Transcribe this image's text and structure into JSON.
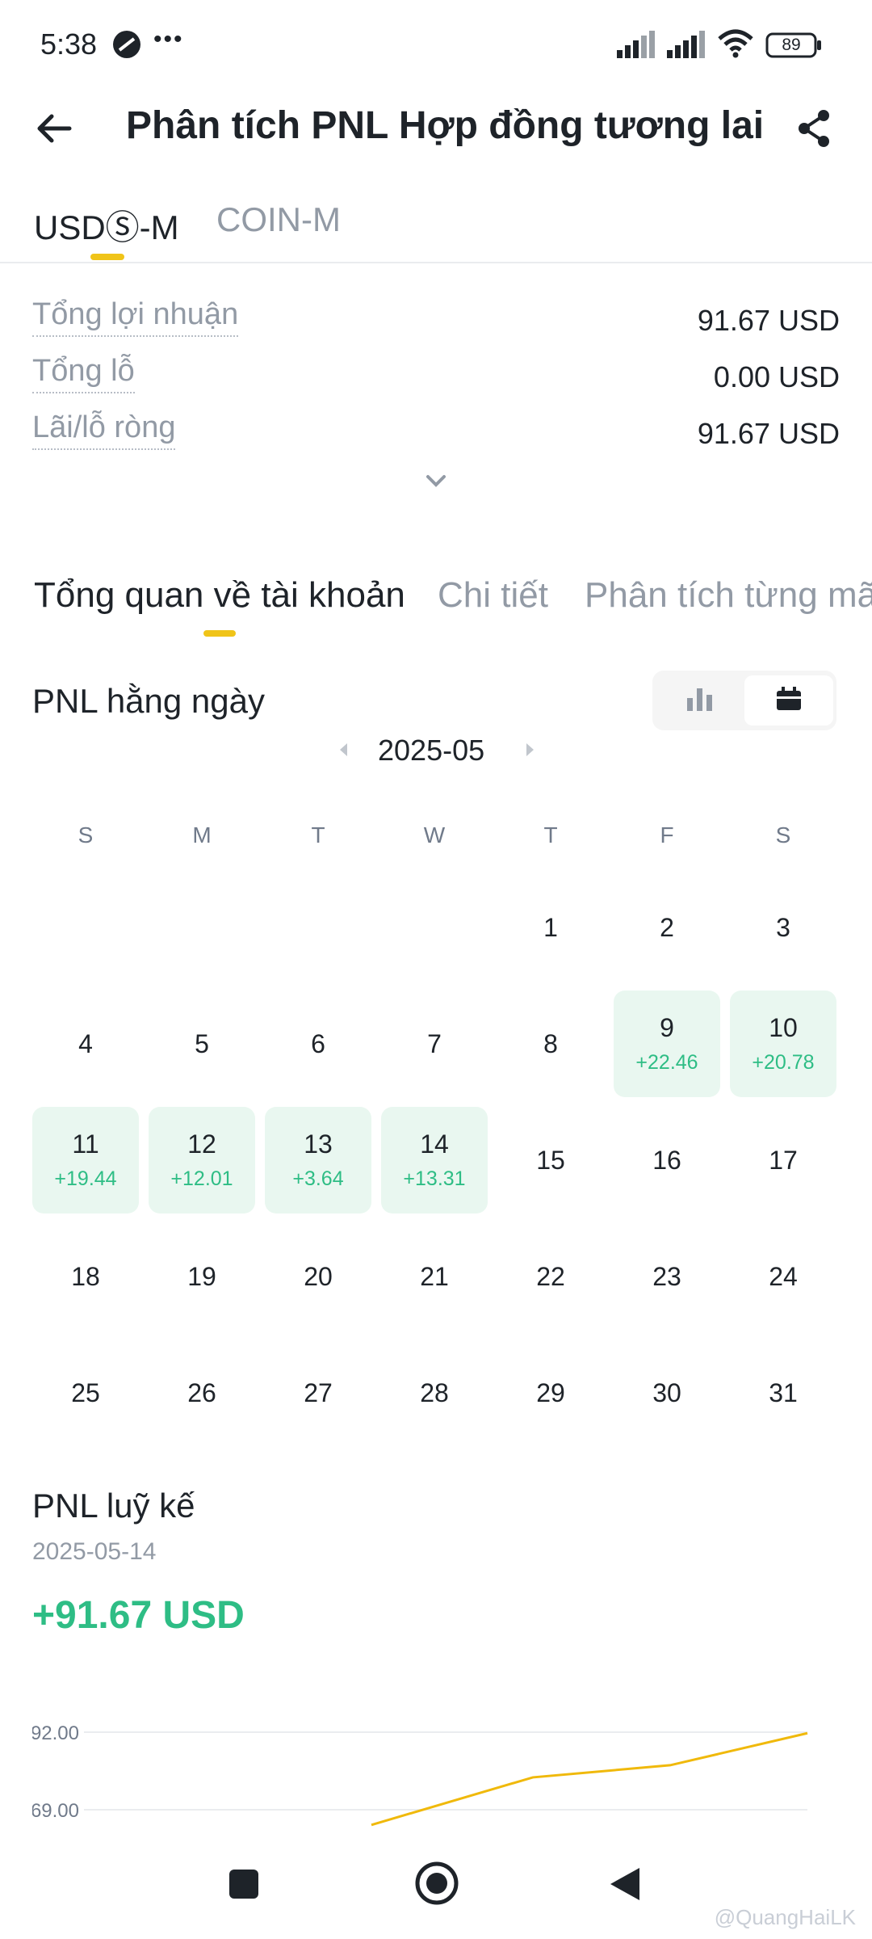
{
  "status_bar": {
    "time": "5:38",
    "dots": "•••",
    "battery": "89"
  },
  "header": {
    "title": "Phân tích PNL Hợp đồng tương lai"
  },
  "contract_tabs": [
    {
      "label": "USDⓈ-M",
      "active": true
    },
    {
      "label": "COIN-M",
      "active": false
    }
  ],
  "summary": [
    {
      "label": "Tổng lợi nhuận",
      "value": "91.67 USD"
    },
    {
      "label": "Tổng lỗ",
      "value": "0.00 USD"
    },
    {
      "label": "Lãi/lỗ ròng",
      "value": "91.67 USD"
    }
  ],
  "section_tabs": [
    {
      "label": "Tổng quan về tài khoản",
      "active": true
    },
    {
      "label": "Chi tiết",
      "active": false
    },
    {
      "label": "Phân tích từng mã",
      "active": false
    }
  ],
  "daily_pnl": {
    "title": "PNL hằng ngày",
    "month": "2025-05",
    "view_icons": [
      "bar-chart-icon",
      "calendar-icon"
    ],
    "active_view": "calendar",
    "weekdays": [
      "S",
      "M",
      "T",
      "W",
      "T",
      "F",
      "S"
    ],
    "weeks": [
      [
        {
          "d": ""
        },
        {
          "d": ""
        },
        {
          "d": ""
        },
        {
          "d": ""
        },
        {
          "d": "1"
        },
        {
          "d": "2"
        },
        {
          "d": "3"
        }
      ],
      [
        {
          "d": "4"
        },
        {
          "d": "5"
        },
        {
          "d": "6"
        },
        {
          "d": "7"
        },
        {
          "d": "8"
        },
        {
          "d": "9",
          "pnl": "+22.46"
        },
        {
          "d": "10",
          "pnl": "+20.78"
        }
      ],
      [
        {
          "d": "11",
          "pnl": "+19.44"
        },
        {
          "d": "12",
          "pnl": "+12.01"
        },
        {
          "d": "13",
          "pnl": "+3.64"
        },
        {
          "d": "14",
          "pnl": "+13.31"
        },
        {
          "d": "15"
        },
        {
          "d": "16"
        },
        {
          "d": "17"
        }
      ],
      [
        {
          "d": "18"
        },
        {
          "d": "19"
        },
        {
          "d": "20"
        },
        {
          "d": "21"
        },
        {
          "d": "22"
        },
        {
          "d": "23"
        },
        {
          "d": "24"
        }
      ],
      [
        {
          "d": "25"
        },
        {
          "d": "26"
        },
        {
          "d": "27"
        },
        {
          "d": "28"
        },
        {
          "d": "29"
        },
        {
          "d": "30"
        },
        {
          "d": "31"
        }
      ]
    ]
  },
  "cumulative": {
    "title": "PNL luỹ kế",
    "date": "2025-05-14",
    "value": "+91.67 USD"
  },
  "chart_data": {
    "type": "line",
    "title": "",
    "xlabel": "",
    "ylabel": "",
    "y_ticks": [
      "92.00",
      "69.00"
    ],
    "ylim": [
      46,
      92
    ],
    "series": [
      {
        "values": [
          64.5,
          78.6,
          82.2,
          91.7
        ]
      }
    ],
    "color": "#f0b90b",
    "grid": true
  },
  "watermark": "@QuangHaiLK",
  "colors": {
    "accent": "#f0c419",
    "profit": "#2ebd85",
    "profit_bg": "#e9f7f0"
  }
}
